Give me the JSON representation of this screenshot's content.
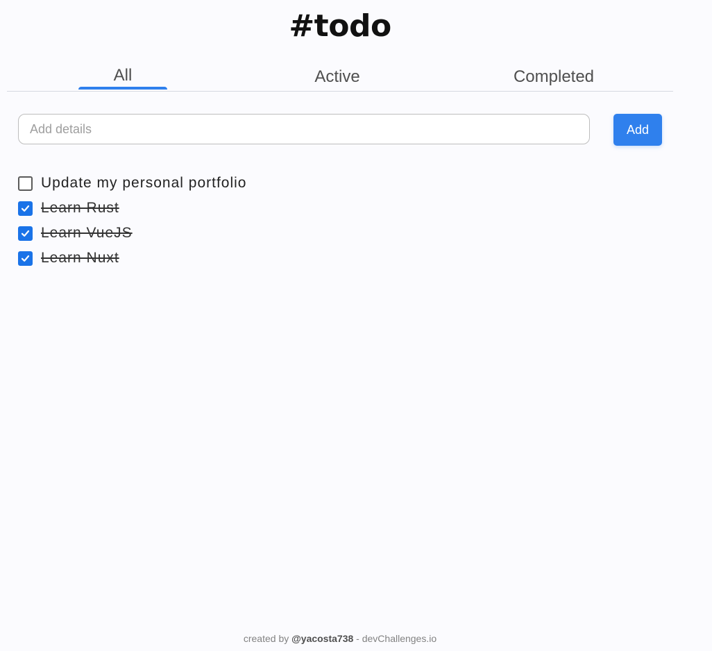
{
  "app": {
    "title": "#todo"
  },
  "tabs": [
    {
      "label": "All",
      "selected": true
    },
    {
      "label": "Active",
      "selected": false
    },
    {
      "label": "Completed",
      "selected": false
    }
  ],
  "add": {
    "placeholder": "Add details",
    "value": "",
    "button_label": "Add"
  },
  "todos": [
    {
      "text": "Update my personal portfolio",
      "completed": false
    },
    {
      "text": "Learn Rust",
      "completed": true
    },
    {
      "text": "Learn VueJS",
      "completed": true
    },
    {
      "text": "Learn Nuxt",
      "completed": true
    }
  ],
  "footer": {
    "prefix": "created by ",
    "author": "@yacosta738",
    "suffix": " - devChallenges.io"
  },
  "colors": {
    "accent": "#2f80ed",
    "checkbox_checked": "#1a73e8",
    "background": "#fbfbfe"
  },
  "icons": {
    "checkbox_checked": "check-icon"
  }
}
